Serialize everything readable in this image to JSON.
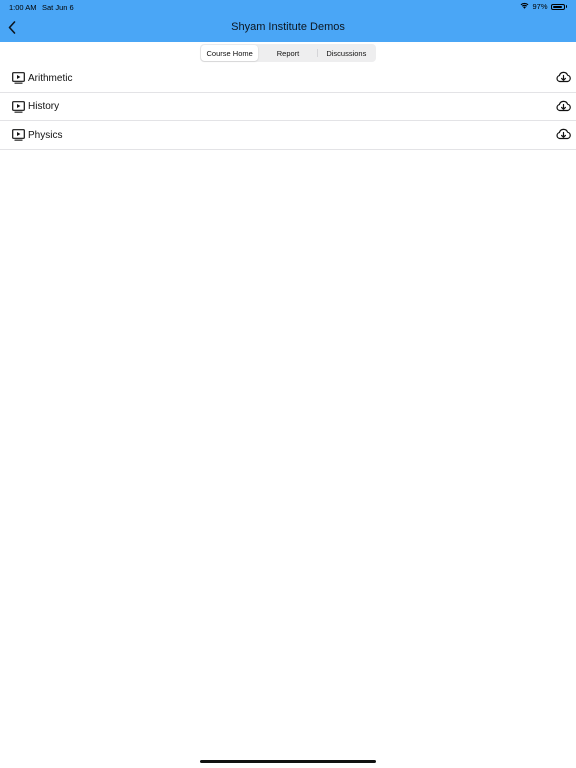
{
  "status_bar": {
    "time": "1:00 AM",
    "date": "Sat Jun 6",
    "battery_text": "97%",
    "battery_level": 0.97,
    "wifi_icon": "wifi-icon",
    "battery_icon": "battery-icon"
  },
  "nav": {
    "title": "Shyam Institute Demos",
    "back_icon": "chevron-left-icon"
  },
  "tabs": [
    {
      "label": "Course Home",
      "selected": true
    },
    {
      "label": "Report",
      "selected": false
    },
    {
      "label": "Discussions",
      "selected": false
    }
  ],
  "courses": [
    {
      "label": "Arithmetic",
      "icon": "video-play-icon",
      "action_icon": "cloud-download-icon"
    },
    {
      "label": "History",
      "icon": "video-play-icon",
      "action_icon": "cloud-download-icon"
    },
    {
      "label": "Physics",
      "icon": "video-play-icon",
      "action_icon": "cloud-download-icon"
    }
  ],
  "colors": {
    "header_bg": "#4aa6f6",
    "segment_bg": "#eeeeef",
    "separator": "#e3e3e6"
  }
}
